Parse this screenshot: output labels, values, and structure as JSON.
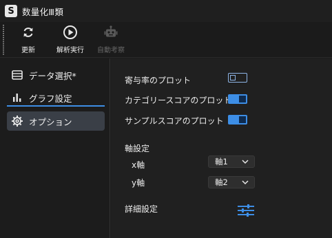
{
  "window": {
    "app_icon_letter": "S",
    "title": "数量化Ⅲ類"
  },
  "toolbar": {
    "refresh_label": "更新",
    "analyze_label": "解析実行",
    "auto_label": "自動考察",
    "accent": "#e8e8e8",
    "disabled_color": "#5a5a5a"
  },
  "sidebar": {
    "items": [
      {
        "label": "データ選択*",
        "icon": "table-icon"
      },
      {
        "label": "グラフ設定",
        "icon": "bar-chart-icon"
      },
      {
        "label": "オプション",
        "icon": "gear-icon",
        "selected": true
      }
    ],
    "accent": "#3d8ee6"
  },
  "options": {
    "contribution_plot_label": "寄与率のプロット",
    "contribution_plot_on": false,
    "category_score_plot_label": "カテゴリースコアのプロット",
    "category_score_plot_on": true,
    "sample_score_plot_label": "サンプルスコアのプロット",
    "sample_score_plot_on": true,
    "axis_settings_label": "軸設定",
    "x_axis_label": "x軸",
    "x_axis_value": "軸1",
    "y_axis_label": "y軸",
    "y_axis_value": "軸2",
    "detail_settings_label": "詳細設定",
    "toggle_color": "#3d8ee6"
  }
}
